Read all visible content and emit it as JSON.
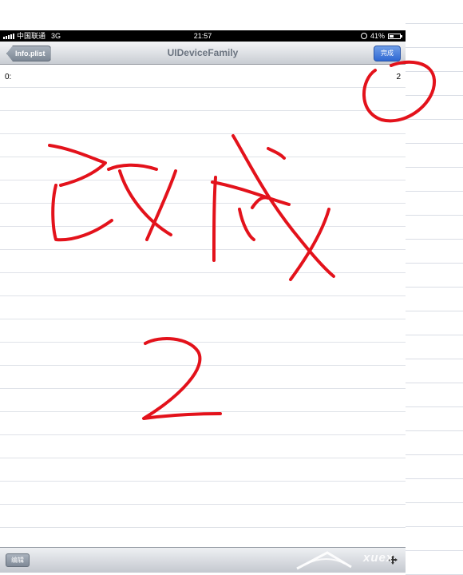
{
  "status_bar": {
    "carrier": "中国联通",
    "network": "3G",
    "time": "21:57",
    "battery": "41%",
    "battery_fraction": 0.41
  },
  "nav_bar": {
    "back_label": "Info.plist",
    "title": "UIDeviceFamily",
    "done_label": "完成"
  },
  "rows": [
    {
      "key": "0:",
      "value": "2"
    }
  ],
  "toolbar": {
    "edit_label": "编辑"
  },
  "annotation": {
    "handwritten_text_line1": "改成",
    "handwritten_text_line2": "2",
    "color": "#e3121b"
  },
  "watermark": {
    "text": "xuex"
  },
  "colors": {
    "done_button": "#3a72d8",
    "nav_title": "#6b7480",
    "annotation_red": "#e3121b"
  }
}
